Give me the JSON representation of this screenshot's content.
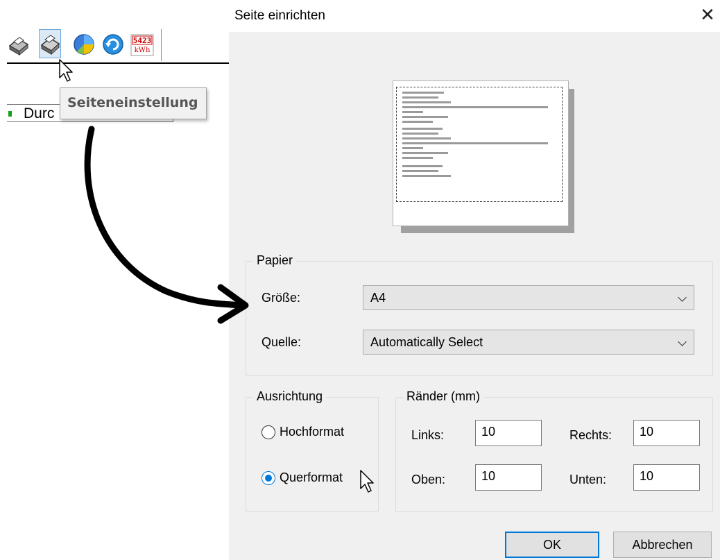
{
  "app": {
    "toolbar": {
      "buttons": [
        {
          "name": "printer-icon"
        },
        {
          "name": "page-setup-printer-icon"
        },
        {
          "name": "pie-chart-icon"
        },
        {
          "name": "refresh-icon"
        },
        {
          "name": "kwh-meter-icon",
          "digits": "5423",
          "unit": "kWh"
        }
      ]
    },
    "tooltip": "Seiteneinstellung",
    "list_item": "Durc"
  },
  "dialog": {
    "title": "Seite einrichten",
    "close_icon": "close-icon",
    "paper": {
      "legend": "Papier",
      "size_label": "Größe:",
      "size_value": "A4",
      "source_label": "Quelle:",
      "source_value": "Automatically Select"
    },
    "orientation": {
      "legend": "Ausrichtung",
      "portrait": "Hochformat",
      "landscape": "Querformat",
      "selected": "landscape"
    },
    "margins": {
      "legend": "Ränder (mm)",
      "left_label": "Links:",
      "left_value": "10",
      "right_label": "Rechts:",
      "right_value": "10",
      "top_label": "Oben:",
      "top_value": "10",
      "bottom_label": "Unten:",
      "bottom_value": "10"
    },
    "ok_label": "OK",
    "cancel_label": "Abbrechen",
    "accent_color": "#0078d7"
  }
}
